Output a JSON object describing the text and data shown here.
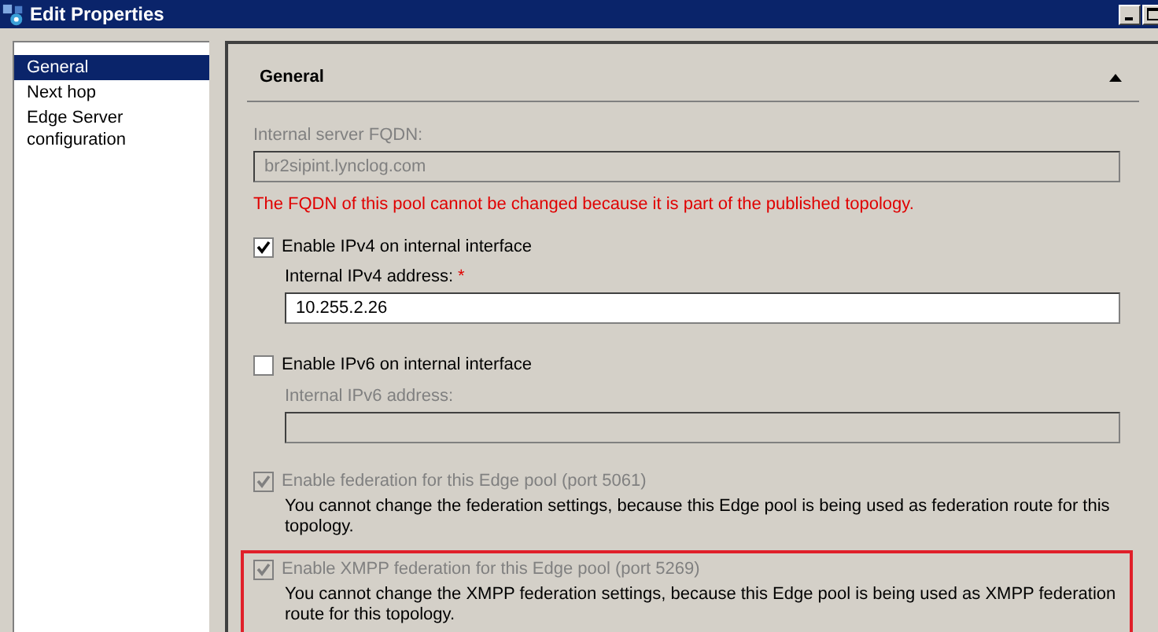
{
  "window": {
    "title": "Edit Properties"
  },
  "sidebar": {
    "items": [
      {
        "label": "General",
        "selected": true
      },
      {
        "label": "Next hop",
        "selected": false
      },
      {
        "label": "Edge Server configuration",
        "selected": false
      }
    ]
  },
  "section": {
    "title": "General",
    "expanded": true
  },
  "fqdn": {
    "label": "Internal server FQDN:",
    "value": "br2sipint.lynclog.com",
    "disabled": true,
    "note": "The FQDN of this pool cannot be changed because it is part of the published topology."
  },
  "ipv4": {
    "label": "Enable IPv4 on internal interface",
    "checked": true,
    "disabled": false,
    "field": {
      "label": "Internal IPv4 address:",
      "required_mark": "*",
      "value": "10.255.2.26",
      "disabled": false
    }
  },
  "ipv6": {
    "label": "Enable IPv6 on internal interface",
    "checked": false,
    "disabled": false,
    "field": {
      "label": "Internal IPv6 address:",
      "disabled": true
    }
  },
  "federation": [
    {
      "label": "Enable federation for this Edge pool (port 5061)",
      "checked": true,
      "disabled": true,
      "note": "You cannot change the federation settings, because this Edge pool is being used as federation route for this topology.",
      "highlighted": false
    },
    {
      "label": "Enable XMPP federation for this Edge pool (port 5269)",
      "checked": true,
      "disabled": true,
      "note": "You cannot change the XMPP federation settings, because this Edge pool is being used as XMPP federation route for this topology.",
      "highlighted": true
    }
  ]
}
